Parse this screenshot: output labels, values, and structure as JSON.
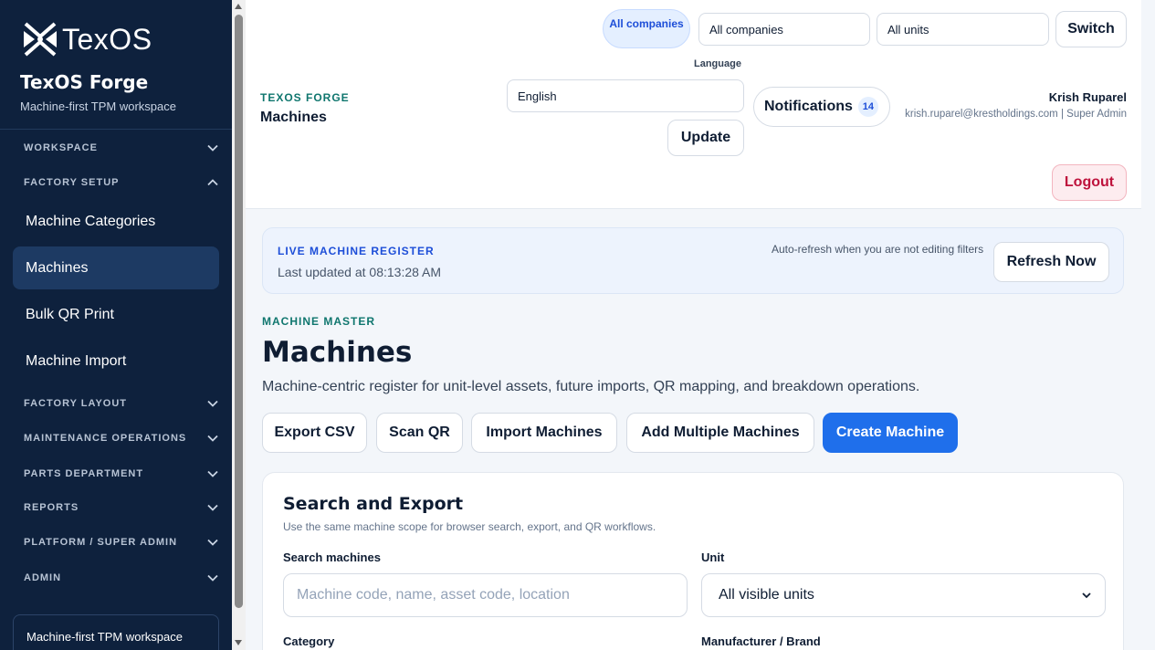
{
  "sidebar": {
    "logo_text": "TexOS",
    "brand_title": "TexOS Forge",
    "brand_subtitle": "Machine-first TPM workspace",
    "sections": {
      "workspace": "WORKSPACE",
      "factory_setup": "FACTORY SETUP",
      "factory_layout": "FACTORY LAYOUT",
      "maintenance_operations": "MAINTENANCE OPERATIONS",
      "parts_department": "PARTS DEPARTMENT",
      "reports": "REPORTS",
      "platform_super_admin": "PLATFORM / SUPER ADMIN",
      "admin": "ADMIN"
    },
    "items": {
      "machine_categories": "Machine Categories",
      "machines": "Machines",
      "bulk_qr_print": "Bulk QR Print",
      "machine_import": "Machine Import"
    },
    "footer_text": "Machine-first TPM workspace"
  },
  "header": {
    "company_pill": "All companies",
    "company_select": "All companies",
    "unit_select": "All units",
    "switch_label": "Switch",
    "language_label": "Language",
    "language_value": "English",
    "update_label": "Update",
    "eyebrow": "TEXOS FORGE",
    "title": "Machines",
    "notifications_label": "Notifications",
    "notifications_count": "14",
    "user_name": "Krish Ruparel",
    "user_meta": "krish.ruparel@krestholdings.com | Super Admin",
    "logout_label": "Logout"
  },
  "banner": {
    "eyebrow": "LIVE MACHINE REGISTER",
    "updated": "Last updated at 08:13:28 AM",
    "note": "Auto-refresh when you are not editing filters",
    "refresh_label": "Refresh Now"
  },
  "main": {
    "eyebrow": "MACHINE MASTER",
    "title": "Machines",
    "description": "Machine-centric register for unit-level assets, future imports, QR mapping, and breakdown operations.",
    "actions": {
      "export_csv": "Export CSV",
      "scan_qr": "Scan QR",
      "import_machines": "Import Machines",
      "add_multiple": "Add Multiple Machines",
      "create_machine": "Create Machine"
    }
  },
  "search_card": {
    "title": "Search and Export",
    "subtitle": "Use the same machine scope for browser search, export, and QR workflows.",
    "search_label": "Search machines",
    "search_placeholder": "Machine code, name, asset code, location",
    "unit_label": "Unit",
    "unit_value": "All visible units",
    "category_label": "Category",
    "manufacturer_label": "Manufacturer / Brand"
  },
  "colors": {
    "sidebar_bg": "#0e213d",
    "sidebar_active": "#1d3a63",
    "primary": "#1f6feb",
    "eyebrow_teal": "#0f766e",
    "logout_red": "#be123c"
  }
}
